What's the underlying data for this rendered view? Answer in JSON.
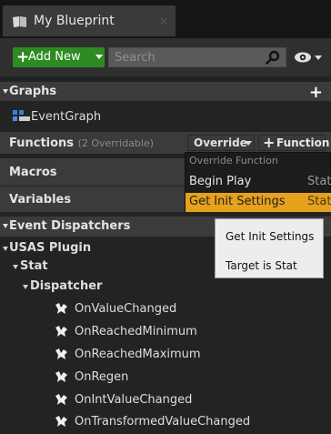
{
  "tab": {
    "title": "My Blueprint",
    "close": "×",
    "icon": "blueprint-icon"
  },
  "toolbar": {
    "add_new_label": "Add New",
    "search_placeholder": "Search",
    "search_icon": "search-icon",
    "eye_icon": "visibility-icon"
  },
  "sections": {
    "graphs": {
      "label": "Graphs",
      "items": [
        {
          "label": "EventGraph",
          "icon": "event-graph-icon"
        }
      ]
    },
    "functions": {
      "label": "Functions",
      "extra": "(2 Overridable)",
      "override_label": "Override",
      "add_function_label": "Function"
    },
    "macros": {
      "label": "Macros"
    },
    "variables": {
      "label": "Variables"
    },
    "event_dispatchers": {
      "label": "Event Dispatchers"
    }
  },
  "dropdown": {
    "heading": "Override Function",
    "items": [
      {
        "label": "Begin Play",
        "suffix": "Stat"
      },
      {
        "label": "Get Init Settings",
        "suffix": "Stat",
        "selected": true
      }
    ]
  },
  "tooltip": {
    "line1": "Get Init Settings",
    "line2": "Target is Stat"
  },
  "tree": {
    "plugin": "USAS Plugin",
    "stat": "Stat",
    "dispatcher": "Dispatcher",
    "events": [
      "OnValueChanged",
      "OnReachedMinimum",
      "OnReachedMaximum",
      "OnRegen",
      "OnIntValueChanged",
      "OnTransformedValueChanged"
    ]
  },
  "colors": {
    "add_new": "#2e8b22",
    "selected": "#e6a11d",
    "panel_bg": "#232323",
    "header_bg": "#3b3b3b"
  }
}
